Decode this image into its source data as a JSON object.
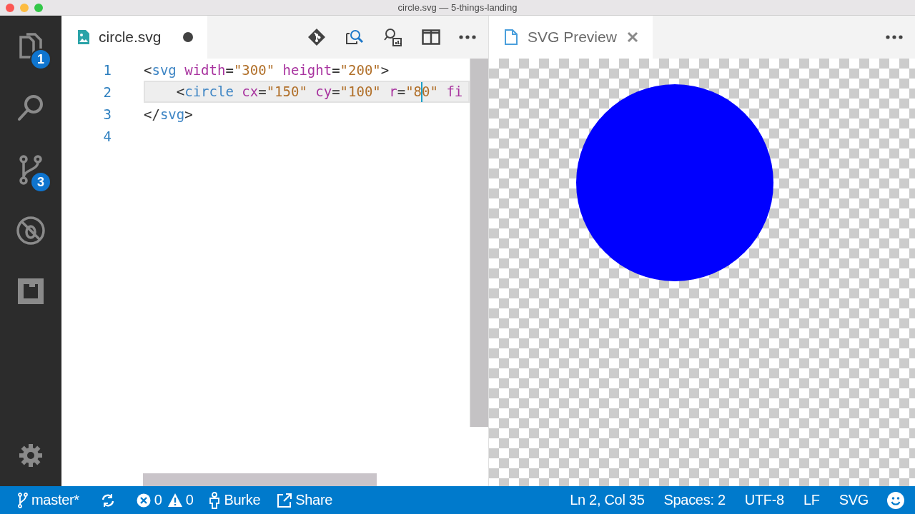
{
  "window": {
    "title": "circle.svg — 5-things-landing"
  },
  "activity_bar": {
    "items": [
      {
        "kind": "explorer",
        "badge": "1"
      },
      {
        "kind": "search"
      },
      {
        "kind": "scm",
        "badge": "3"
      },
      {
        "kind": "debug"
      },
      {
        "kind": "extensions"
      }
    ]
  },
  "editor": {
    "tab": {
      "label": "circle.svg",
      "dirty": true
    },
    "lines": [
      {
        "number": "1",
        "current": false,
        "tokens": [
          {
            "kind": "punct",
            "text": "<"
          },
          {
            "kind": "tag",
            "text": "svg"
          },
          {
            "kind": "attr",
            "text": " width"
          },
          {
            "kind": "punct",
            "text": "="
          },
          {
            "kind": "string",
            "text": "\"300\""
          },
          {
            "kind": "attr",
            "text": " height"
          },
          {
            "kind": "punct",
            "text": "="
          },
          {
            "kind": "string",
            "text": "\"200\""
          },
          {
            "kind": "punct",
            "text": ">"
          }
        ]
      },
      {
        "number": "2",
        "current": true,
        "tokens": [
          {
            "kind": "punct",
            "text": "    <"
          },
          {
            "kind": "tag",
            "text": "circle"
          },
          {
            "kind": "attr",
            "text": " cx"
          },
          {
            "kind": "punct",
            "text": "="
          },
          {
            "kind": "string",
            "text": "\"150\""
          },
          {
            "kind": "attr",
            "text": " cy"
          },
          {
            "kind": "punct",
            "text": "="
          },
          {
            "kind": "string",
            "text": "\"100\""
          },
          {
            "kind": "attr",
            "text": " r"
          },
          {
            "kind": "punct",
            "text": "="
          },
          {
            "kind": "string",
            "text": "\"8"
          },
          {
            "kind": "cursor"
          },
          {
            "kind": "string",
            "text": "0\""
          },
          {
            "kind": "attr",
            "text": " fi"
          }
        ]
      },
      {
        "number": "3",
        "current": false,
        "tokens": [
          {
            "kind": "punct",
            "text": "</"
          },
          {
            "kind": "tag",
            "text": "svg"
          },
          {
            "kind": "punct",
            "text": ">"
          }
        ]
      },
      {
        "number": "4",
        "current": false
      }
    ]
  },
  "preview": {
    "tab": {
      "label": "SVG Preview"
    }
  },
  "status_bar": {
    "left": [
      {
        "kind": "branch",
        "label": "master*"
      },
      {
        "kind": "sync"
      },
      {
        "kind": "errors",
        "label": "0"
      },
      {
        "kind": "warnings",
        "label": "0"
      },
      {
        "kind": "person",
        "label": "Burke"
      },
      {
        "kind": "share",
        "label": "Share"
      }
    ],
    "right": [
      "Ln 2, Col 35",
      "Spaces: 2",
      "UTF-8",
      "LF",
      "SVG"
    ]
  }
}
